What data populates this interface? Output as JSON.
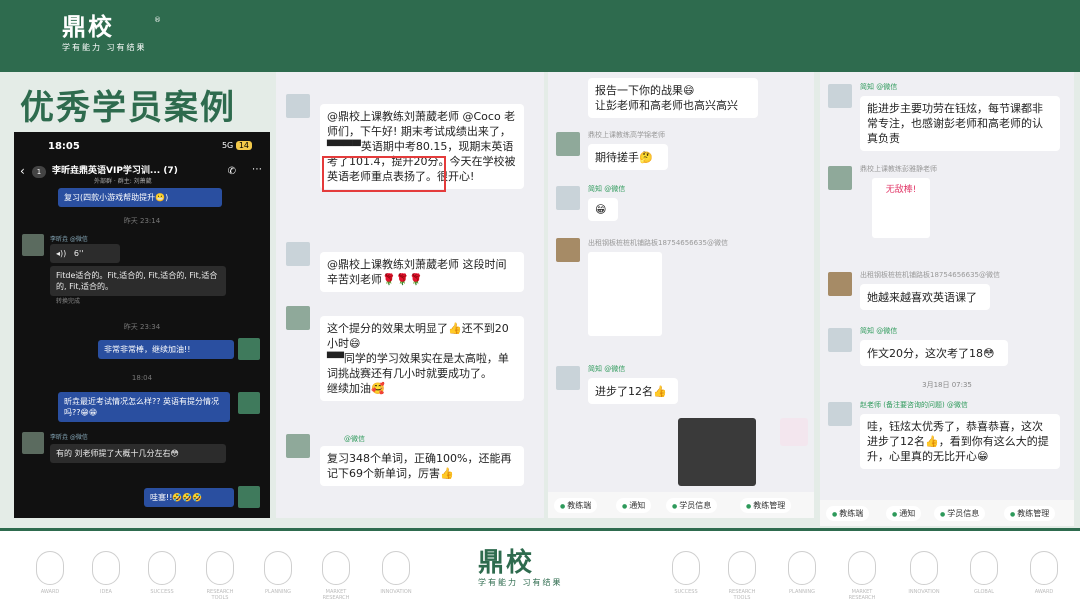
{
  "header": {
    "brand": "鼎校",
    "slogan": "学有能力 习有结果",
    "reg": "®"
  },
  "title": "优秀学员案例",
  "phone": {
    "time": "18:05",
    "signal": "5G",
    "battery": "14",
    "back_badge": "1",
    "chat_title": "李昕垚鼎英语VIP学习训...",
    "member_count": "(7)",
    "subtitle": "外部群 · 群主: 刘萧葳",
    "msg1": "复习(四款小游戏帮助提升😬)",
    "time1": "昨天 23:14",
    "sender1": "李昕垚 @微信",
    "voice": "6''",
    "voice_text": "Fitde适合的。Fit,适合的, Fit,适合的, Fit,适合的, Fit,适合的。",
    "voice_note": "转换完成",
    "time2": "昨天 23:34",
    "msg2": "非常非常棒，继续加油!!",
    "time3": "18:04",
    "msg3": "昕垚最近考试情况怎么样?? 英语有提分情况吗??😁😁",
    "sender2": "李昕垚 @微信",
    "msg4": "有的 刘老师提了大概十几分左右😳",
    "msg5": "哇塞!!🤣🤣🤣"
  },
  "panel2": {
    "m1": "@鼎校上课教练刘萧葳老师 @Coco 老师们，下午好! 期末考试成绩出来了，▀▀▀▀英语期中考80.15，现期末英语考了101.4，提升20分。今天在学校被英语老师重点表扬了。很开心!",
    "m2": "@鼎校上课教练刘萧葳老师 这段时间辛苦刘老师🌹🌹🌹",
    "m3": "这个提分的效果太明显了👍还不到20小时😄",
    "m3b": "▀▀同学的学习效果实在是太高啦，单词挑战赛还有几小时就要成功了。",
    "m3c": "继续加油🥰",
    "wx_label": "@微信",
    "m4": "复习348个单词，正确100%，还能再记下69个新单词，厉害👍"
  },
  "panel3": {
    "m1": "报告一下你的战果😄",
    "m1b": "让彭老师和高老师也高兴高兴",
    "label1": "鼎校上课教练高学锦老师",
    "m2": "期待搓手🤔",
    "label2": "简知 @微信",
    "m3": "😁",
    "label3": "出租钢板桩桩机铺路板18754656635@微信",
    "label4": "简知 @微信",
    "m4": "进步了12名👍",
    "tabs": [
      "教练端",
      "通知",
      "学员信息",
      "教练管理"
    ]
  },
  "panel4": {
    "label1": "简知 @微信",
    "m1": "能进步主要功劳在钰炫，每节课都非常专注，也感谢彭老师和高老师的认真负责",
    "label2": "鼎校上课教练彭雅静老师",
    "sticker": "无敌棒!",
    "label3": "出租钢板桩桩机铺路板18754656635@微信",
    "m2": "她越来越喜欢英语课了",
    "label4": "简知 @微信",
    "m3": "作文20分，这次考了18😳",
    "date": "3月18日 07:35",
    "label5": "赵老师 (备注要咨询的问题) @微信",
    "m4": "哇，钰炫太优秀了，恭喜恭喜，这次进步了12名👍，看到你有这么大的提升，心里真的无比开心😁",
    "tabs": [
      "教练端",
      "通知",
      "学员信息",
      "教练管理"
    ]
  },
  "footer": {
    "brand": "鼎校",
    "slogan": "学有能力 习有结果",
    "icon_labels": [
      "AWARD",
      "IDEA",
      "SUCCESS",
      "RESEARCH TOOLS",
      "PLANNING",
      "MARKET RESEARCH",
      "INNOVATION",
      "SUCCESS",
      "RESEARCH TOOLS",
      "PLANNING",
      "MARKET RESEARCH",
      "INNOVATION",
      "GLOBAL",
      "AWARD"
    ]
  },
  "colors": {
    "brand_green": "#2e6b4e",
    "band": "#e4ece7",
    "highlight": "#e43b3b",
    "wechat_green": "#2e9a5b"
  }
}
